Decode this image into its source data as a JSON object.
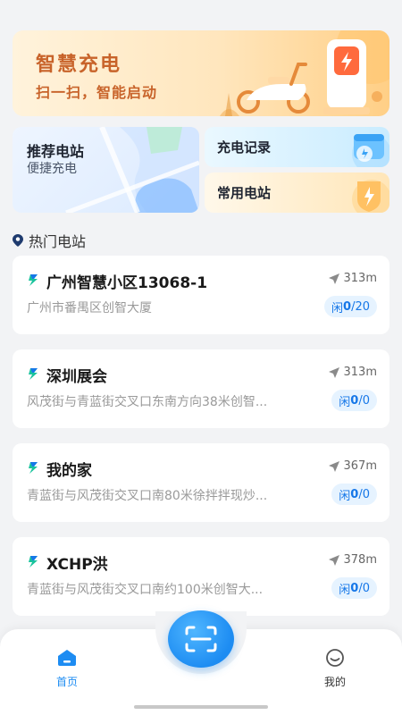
{
  "banner": {
    "title": "智慧充电",
    "subtitle": "扫一扫，智能启动"
  },
  "quick_cards": {
    "recommend": {
      "title": "推荐电站",
      "subtitle": "便捷充电"
    },
    "record": {
      "title": "充电记录"
    },
    "common": {
      "title": "常用电站"
    }
  },
  "section": {
    "title": "热门电站",
    "icon": "location-pin-icon"
  },
  "stations": [
    {
      "name": "广州智慧小区13068-1",
      "address": "广州市番禺区创智大厦",
      "distance": "313m",
      "idle_label": "闲",
      "idle_count": "0",
      "idle_total": "/20"
    },
    {
      "name": "深圳展会",
      "address": "风茂街与青蓝街交叉口东南方向38米创智...",
      "distance": "313m",
      "idle_label": "闲",
      "idle_count": "0",
      "idle_total": "/0"
    },
    {
      "name": "我的家",
      "address": "青蓝街与风茂街交叉口南80米徐拌拌现炒...",
      "distance": "367m",
      "idle_label": "闲",
      "idle_count": "0",
      "idle_total": "/0"
    },
    {
      "name": "XCHP洪",
      "address": "青蓝街与风茂街交叉口南约100米创智大...",
      "distance": "378m",
      "idle_label": "闲",
      "idle_count": "0",
      "idle_total": "/0"
    }
  ],
  "nav": {
    "home_label": "首页",
    "mine_label": "我的",
    "scan_icon": "scan-icon"
  },
  "colors": {
    "accent": "#1d8cf2",
    "banner_text": "#c8632a",
    "idle_bg": "#e6f3ff"
  }
}
